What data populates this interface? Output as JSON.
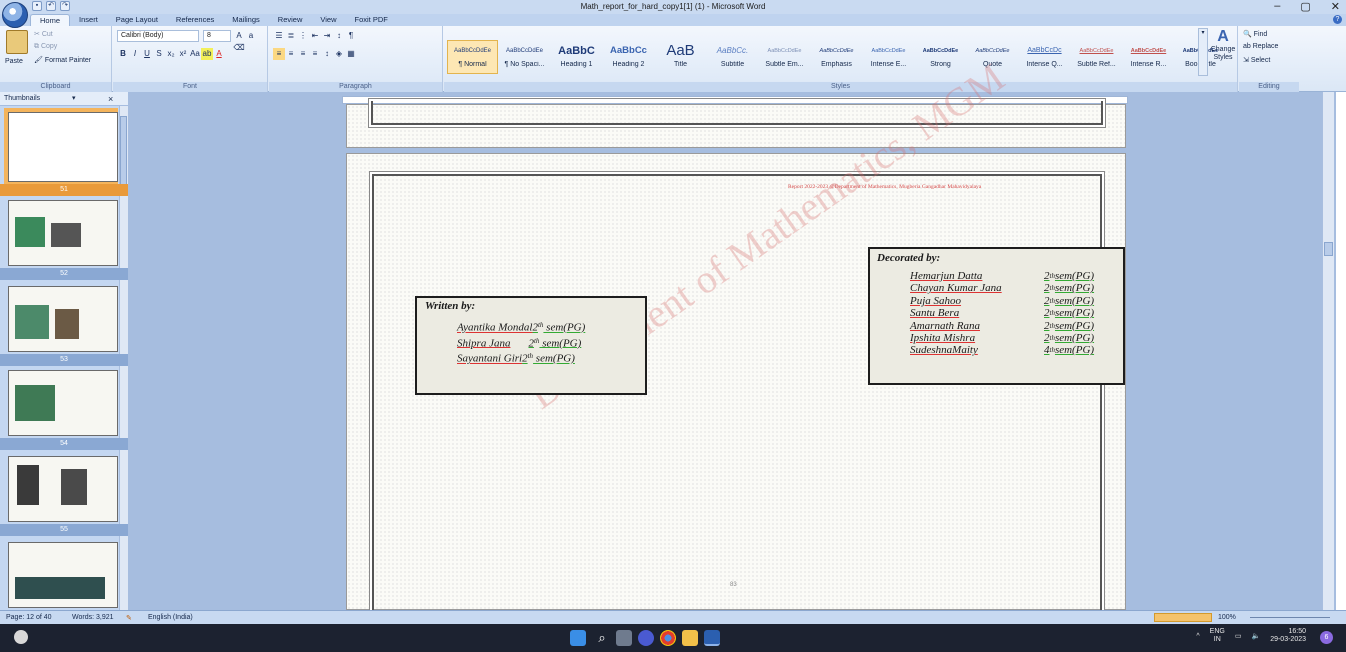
{
  "window": {
    "title": "Math_report_for_hard_copy1[1] (1) - Microsoft Word",
    "controls": [
      "–",
      "▢",
      "✕"
    ]
  },
  "tabs": [
    "Home",
    "Insert",
    "Page Layout",
    "References",
    "Mailings",
    "Review",
    "View",
    "Foxit PDF"
  ],
  "ribbon": {
    "clipboard": {
      "paste": "Paste",
      "cut": "Cut",
      "copy": "Copy",
      "format_painter": "Format Painter",
      "label": "Clipboard"
    },
    "font": {
      "name": "Calibri (Body)",
      "size": "8",
      "label": "Font"
    },
    "paragraph": {
      "label": "Paragraph"
    },
    "styles": {
      "label": "Styles",
      "items": [
        {
          "sample": "AaBbCcDdEe",
          "name": "¶ Normal",
          "selected": true
        },
        {
          "sample": "AaBbCcDdEe",
          "name": "¶ No Spaci..."
        },
        {
          "sample": "AaBbC",
          "name": "Heading 1"
        },
        {
          "sample": "AaBbCc",
          "name": "Heading 2"
        },
        {
          "sample": "AaB",
          "name": "Title"
        },
        {
          "sample": "AaBbCc.",
          "name": "Subtitle"
        },
        {
          "sample": "AaBbCcDdEe",
          "name": "Subtle Em..."
        },
        {
          "sample": "AaBbCcDdEe",
          "name": "Emphasis"
        },
        {
          "sample": "AaBbCcDdEe",
          "name": "Intense E..."
        },
        {
          "sample": "AaBbCcDdEe",
          "name": "Strong"
        },
        {
          "sample": "AaBbCcDdEe",
          "name": "Quote"
        },
        {
          "sample": "AaBbCcDc",
          "name": "Intense Q..."
        },
        {
          "sample": "AaBbCcDdEe",
          "name": "Subtle Ref..."
        },
        {
          "sample": "AaBbCcDdEe",
          "name": "Intense R..."
        },
        {
          "sample": "AaBbCcDdEe",
          "name": "Book Title"
        }
      ],
      "change_styles": "Change Styles"
    },
    "editing": {
      "find": "Find",
      "replace": "Replace",
      "select": "Select",
      "label": "Editing"
    }
  },
  "nav": {
    "header": "Thumbnails",
    "pages": [
      "51",
      "52",
      "53",
      "54",
      "55"
    ],
    "selected": "51"
  },
  "document": {
    "header_line": "Report 2022-2023 @Department of Mathematics, Mugberia Gangadhar Mahavidyalaya",
    "watermark": "Department of Mathematics, MGM",
    "written_by": {
      "title": "Written by:",
      "rows": [
        {
          "name": "Ayantika Mondal",
          "ord": "2",
          "sup": "th",
          "sem": " sem(PG)"
        },
        {
          "name": "Shipra Jana",
          "ord": "2",
          "sup": "th",
          "sem": " sem(PG)"
        },
        {
          "name": "Sayantani Giri",
          "ord": "2",
          "sup": "th",
          "sem": " sem(PG)"
        }
      ]
    },
    "decorated_by": {
      "title": "Decorated by:",
      "rows": [
        {
          "name": "Hemarjun Datta",
          "ord": "2",
          "sup": "th",
          "sem": " sem(PG)"
        },
        {
          "name": "Chayan Kumar Jana",
          "ord": "2",
          "sup": "th",
          "sem": "sem(PG)"
        },
        {
          "name": "Puja Sahoo",
          "ord": "2",
          "sup": "th",
          "sem": "sem(PG)"
        },
        {
          "name": "Santu Bera",
          "ord": "2",
          "sup": "th",
          "sem": "sem(PG)"
        },
        {
          "name": "Amarnath Rana",
          "ord": "2",
          "sup": "th",
          "sem": "sem(PG)"
        },
        {
          "name": "Ipshita Mishra",
          "ord": "2",
          "sup": "th",
          "sem": "sem(PG)"
        },
        {
          "name": "SudeshnaMaity",
          "ord": "4",
          "sup": "th",
          "sem": "sem(PG)"
        }
      ]
    },
    "page_number": "83"
  },
  "status": {
    "page": "Page: 12 of 40",
    "words": "Words: 3,921",
    "language": "English (India)",
    "zoom": "100%"
  },
  "taskbar": {
    "lang": "ENG",
    "region": "IN",
    "time": "16:50",
    "date": "29-03-2023",
    "notifications": "6"
  }
}
